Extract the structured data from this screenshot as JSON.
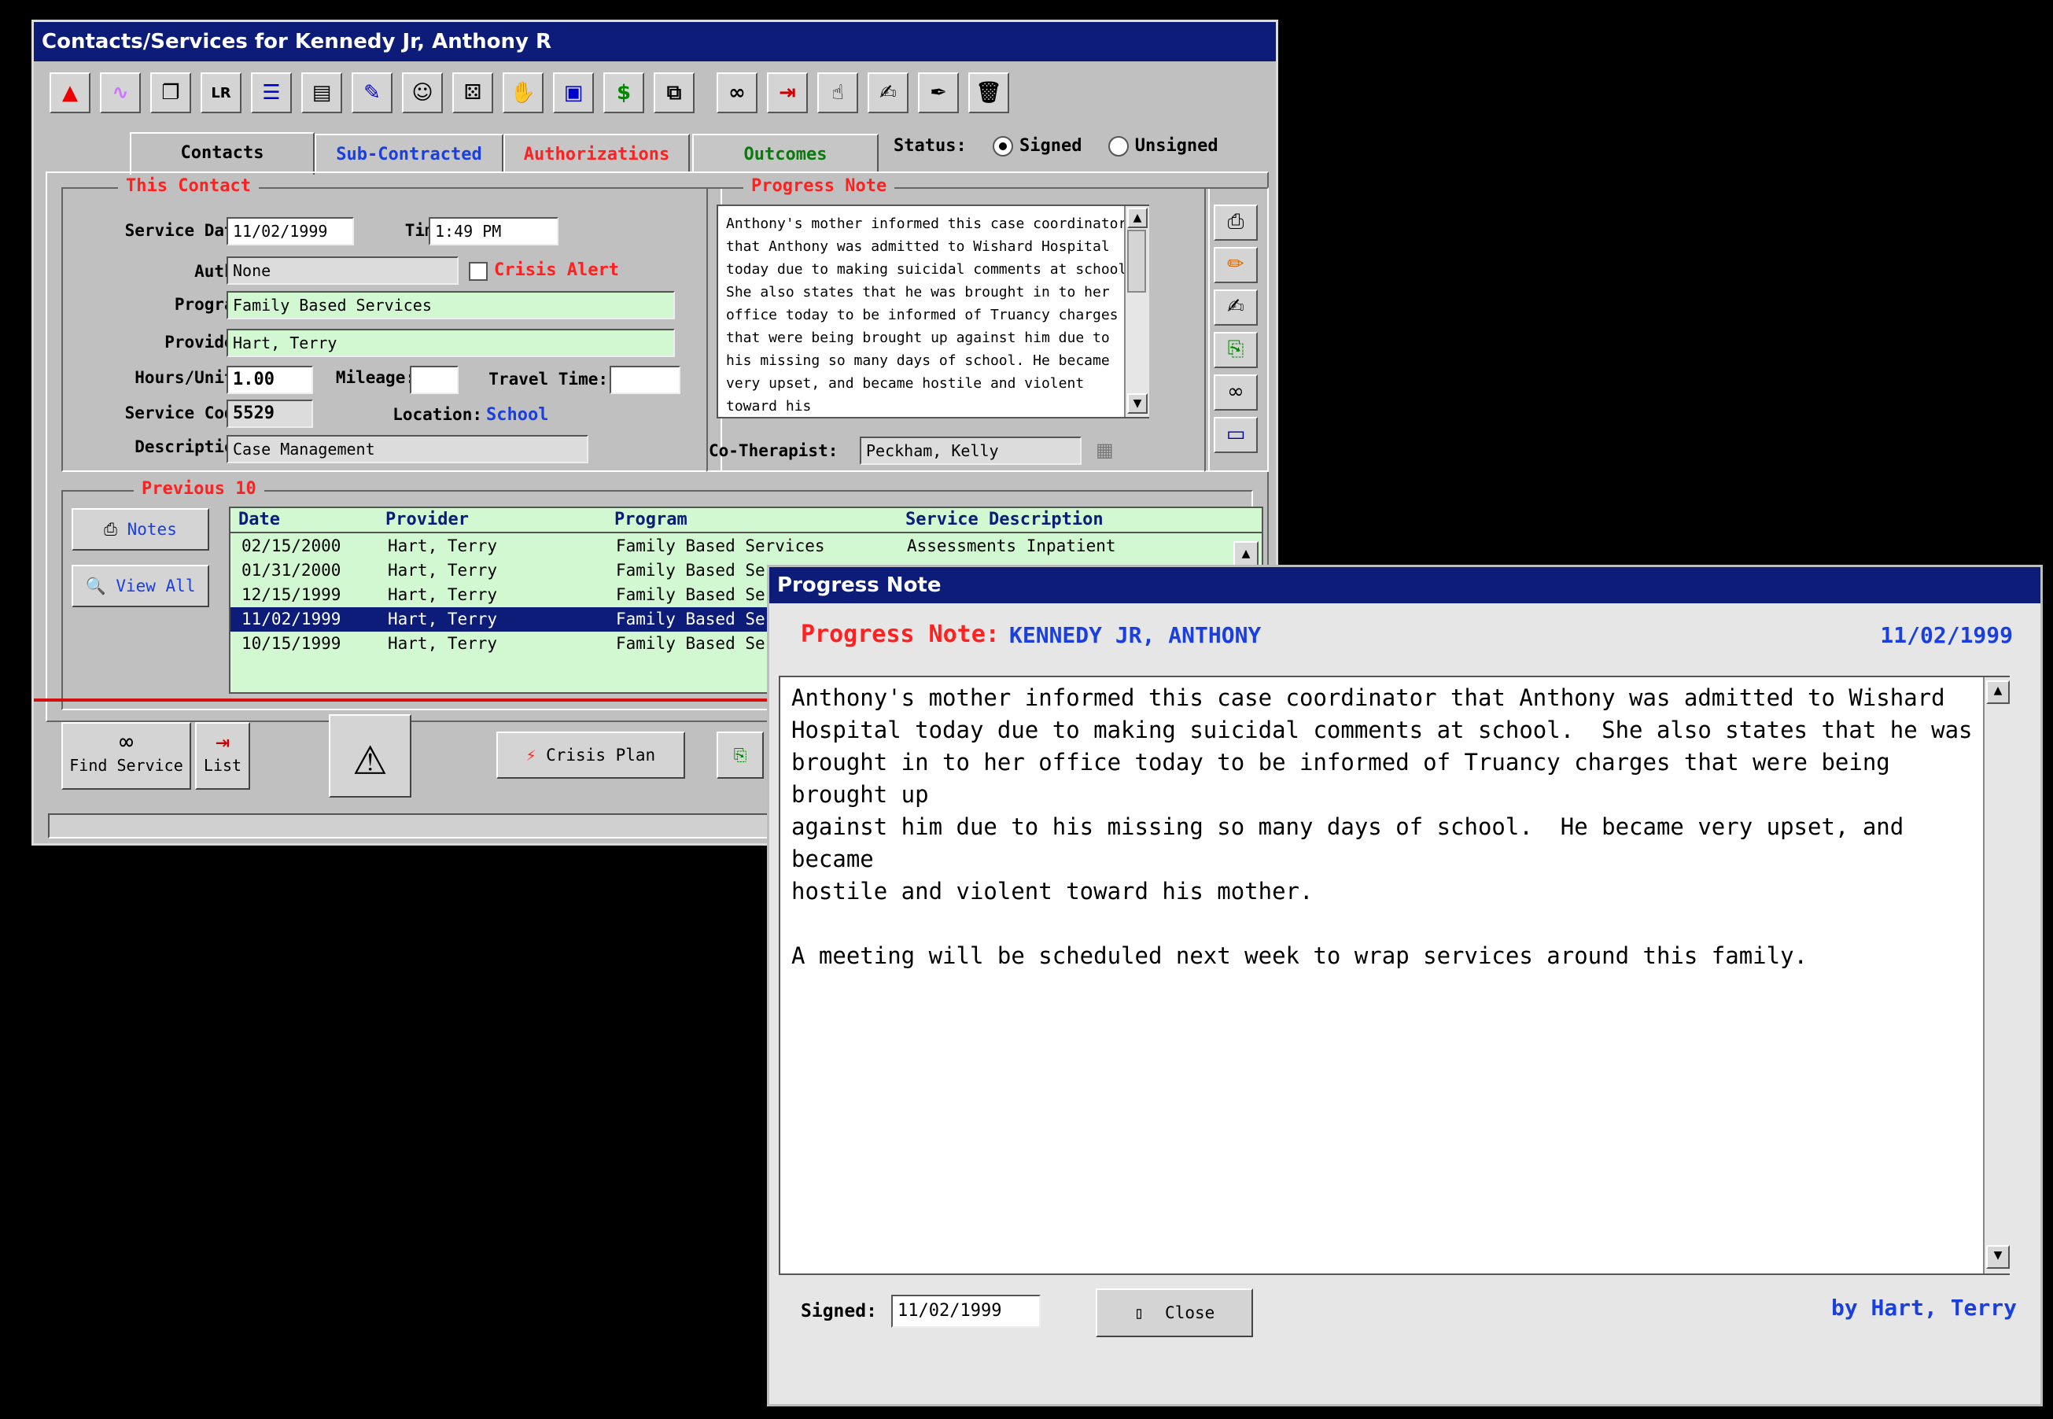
{
  "main_window": {
    "title": "Contacts/Services for Kennedy Jr, Anthony R",
    "toolbar_icons": [
      "up-arrow-icon",
      "link-icon",
      "window-icon",
      "lr-icon",
      "list-icon",
      "clipboard-icon",
      "edit-form-icon",
      "people-icon",
      "dice-icon",
      "handshake-icon",
      "document-icon",
      "dollar-icon",
      "copy-icon",
      "binoculars-icon",
      "exit-icon",
      "hand-icon",
      "sign-icon",
      "pen-hand-icon",
      "trash-icon"
    ],
    "tabs": {
      "contacts": "Contacts",
      "subcontracted": "Sub-Contracted",
      "authorizations": "Authorizations",
      "outcomes": "Outcomes"
    },
    "status": {
      "label": "Status:",
      "signed": "Signed",
      "unsigned": "Unsigned",
      "selected": "Signed"
    },
    "this_contact": {
      "legend": "This Contact",
      "service_date_label": "Service Date:",
      "service_date": "11/02/1999",
      "time_label": "Time:",
      "time": "1:49 PM",
      "auth_label": "Auth#:",
      "auth": "None",
      "crisis_alert_label": "Crisis Alert",
      "program_label": "Program:",
      "program": "Family Based Services",
      "provider_label": "Provider:",
      "provider": "Hart, Terry",
      "hours_label": "Hours/Units:",
      "hours": "1.00",
      "mileage_label": "Mileage:",
      "mileage": "",
      "travel_label": "Travel Time:",
      "travel": "",
      "service_code_label": "Service Code:",
      "service_code": "5529",
      "location_label": "Location:",
      "location": "School",
      "description_label": "Description:",
      "description": "Case Management"
    },
    "progress_note": {
      "legend": "Progress Note",
      "text": "Anthony's mother informed this case coordinator that Anthony was admitted to Wishard Hospital today due to making suicidal comments at school.  She also states that he was brought in to her office today to be informed of Truancy charges that were being brought up against him due to his missing so many days of school.  He became very upset, and became hostile and violent toward his",
      "cotherapist_label": "Co-Therapist:",
      "cotherapist": "Peckham, Kelly"
    },
    "previous": {
      "legend": "Previous 10",
      "notes_button": "Notes",
      "view_all_button": "View All",
      "columns": {
        "date": "Date",
        "provider": "Provider",
        "program": "Program",
        "service": "Service Description"
      },
      "rows": [
        {
          "date": "02/15/2000",
          "provider": "Hart, Terry",
          "program": "Family Based Services",
          "service": "Assessments Inpatient"
        },
        {
          "date": "01/31/2000",
          "provider": "Hart, Terry",
          "program": "Family Based Ser",
          "service": ""
        },
        {
          "date": "12/15/1999",
          "provider": "Hart, Terry",
          "program": "Family Based Ser",
          "service": ""
        },
        {
          "date": "11/02/1999",
          "provider": "Hart, Terry",
          "program": "Family Based Ser",
          "service": ""
        },
        {
          "date": "10/15/1999",
          "provider": "Hart, Terry",
          "program": "Family Based Ser",
          "service": ""
        }
      ]
    },
    "bottom": {
      "find_service": "Find Service",
      "list": "List",
      "crisis_plan": "Crisis Plan"
    }
  },
  "dialog": {
    "title": "Progress Note",
    "heading_label": "Progress Note:",
    "patient": "KENNEDY JR, ANTHONY",
    "date": "11/02/1999",
    "text": "Anthony's mother informed this case coordinator that Anthony was admitted to Wishard\nHospital today due to making suicidal comments at school.  She also states that he was\nbrought in to her office today to be informed of Truancy charges that were being brought up\nagainst him due to his missing so many days of school.  He became very upset, and became\nhostile and violent toward his mother.\n\nA meeting will be scheduled next week to wrap services around this family.",
    "signed_label": "Signed:",
    "signed_date": "11/02/1999",
    "close_button": "Close",
    "by": "by Hart, Terry"
  }
}
